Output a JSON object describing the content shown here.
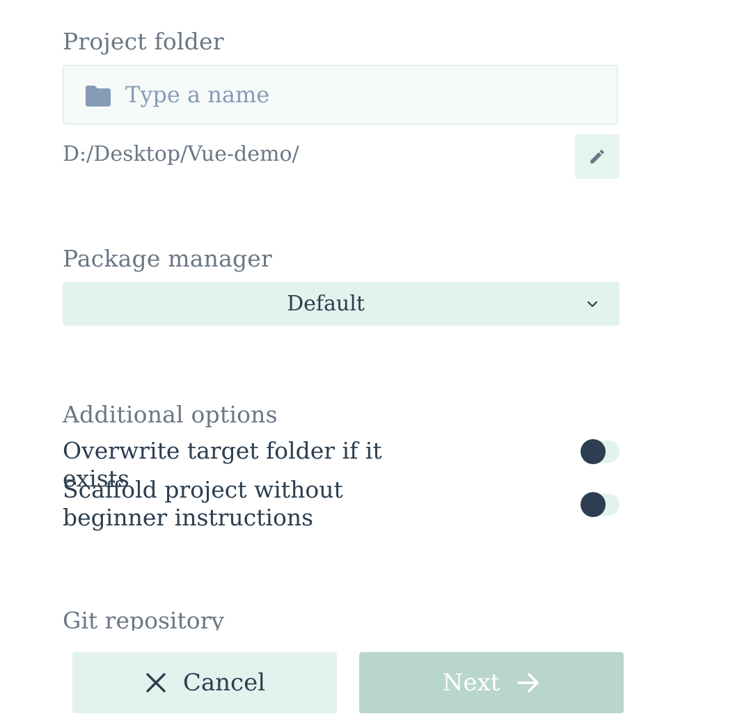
{
  "project_folder": {
    "label": "Project folder",
    "name_placeholder": "Type a name",
    "name_value": "",
    "folder_icon": "folder-icon",
    "path": "D:/Desktop/Vue-demo/",
    "edit_icon": "pencil-icon"
  },
  "package_manager": {
    "label": "Package manager",
    "selected": "Default",
    "dropdown_icon": "chevron-down-icon"
  },
  "additional_options": {
    "label": "Additional options",
    "options": [
      {
        "label": "Overwrite target folder if it exists",
        "enabled": false
      },
      {
        "label": "Scaffold project without beginner instructions",
        "enabled": false
      }
    ]
  },
  "git": {
    "label": "Git repository"
  },
  "footer": {
    "cancel_label": "Cancel",
    "cancel_icon": "close-icon",
    "next_label": "Next",
    "next_icon": "arrow-right-icon",
    "next_disabled": true
  },
  "colors": {
    "text": "#2c3e50",
    "muted": "#6b7785",
    "placeholder": "#869bb5",
    "accent_light": "#e2f3ed",
    "next_disabled_bg": "#b8d6c9"
  }
}
